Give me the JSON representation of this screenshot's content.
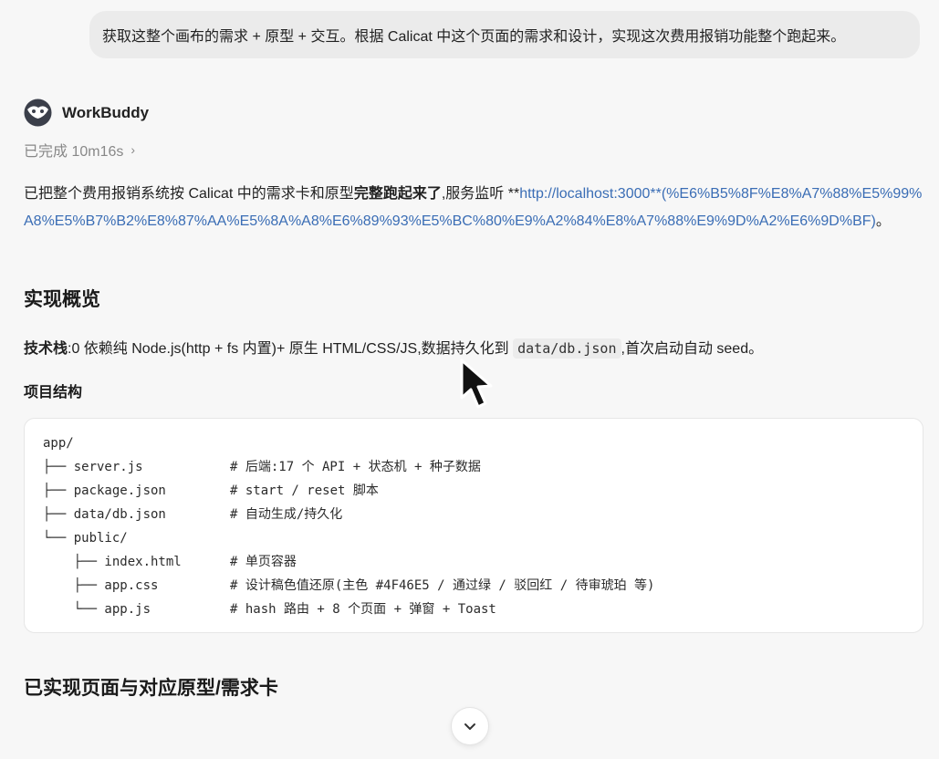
{
  "user_message": "获取这整个画布的需求 + 原型 + 交互。根据 Calicat 中这个页面的需求和设计，实现这次费用报销功能整个跑起来。",
  "agent": {
    "name": "WorkBuddy",
    "status": "已完成 10m16s",
    "status_chevron": "›"
  },
  "summary": {
    "prefix": "已把整个费用报销系统按 Calicat 中的需求卡和原型",
    "bold": "完整跑起来了",
    "middle": ",服务监听 **",
    "link_text": "http://localhost:3000**(%E6%B5%8F%E8%A7%88%E5%99%A8%E5%B7%B2%E8%87%AA%E5%8A%A8%E6%89%93%E5%BC%80%E9%A2%84%E8%A7%88%E9%9D%A2%E6%9D%BF)",
    "suffix": "。"
  },
  "section1_title": "实现概览",
  "tech": {
    "label": "技术栈",
    "text": ":0 依赖纯 Node.js(http + fs 内置)+ 原生 HTML/CSS/JS,数据持久化到 ",
    "code": "data/db.json",
    "suffix": ",首次启动自动 seed。"
  },
  "structure_title": "项目结构",
  "code_lines": [
    {
      "text": "app/",
      "comment": ""
    },
    {
      "text": "├── server.js",
      "comment": "# 后端:17 个 API + 状态机 + 种子数据"
    },
    {
      "text": "├── package.json",
      "comment": "# start / reset 脚本"
    },
    {
      "text": "├── data/db.json",
      "comment": "# 自动生成/持久化"
    },
    {
      "text": "└── public/",
      "comment": ""
    },
    {
      "text": "    ├── index.html",
      "comment": "# 单页容器"
    },
    {
      "text": "    ├── app.css",
      "comment": "# 设计稿色值还原(主色 #4F46E5 / 通过绿 / 驳回红 / 待审琥珀 等)"
    },
    {
      "text": "    └── app.js",
      "comment": "# hash 路由 + 8 个页面 + 弹窗 + Toast"
    }
  ],
  "section2_title": "已实现页面与对应原型/需求卡",
  "icons": {
    "avatar": "workbuddy-avatar-icon",
    "scroll": "chevron-down-icon",
    "cursor": "mouse-cursor-icon"
  }
}
